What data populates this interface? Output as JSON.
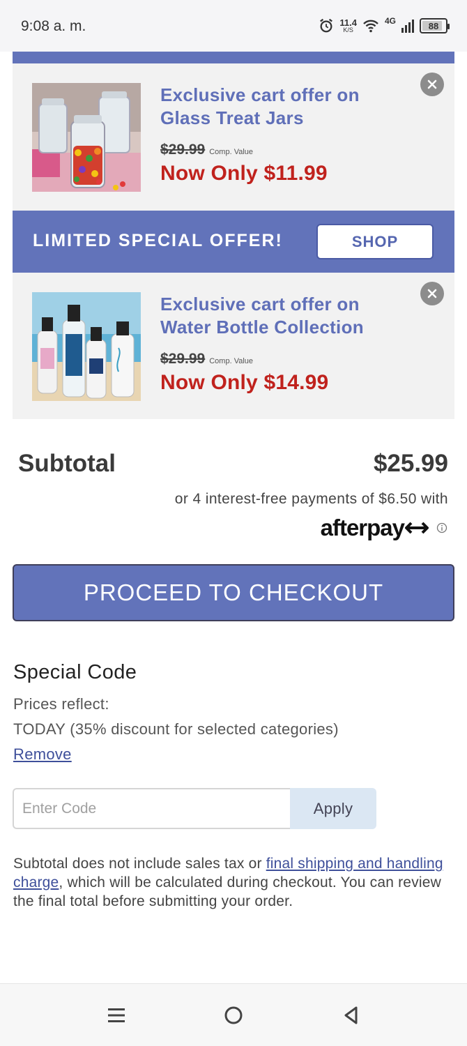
{
  "status_bar": {
    "time": "9:08 a. m.",
    "speed_value": "11.4",
    "speed_unit": "K/S",
    "network": "4G",
    "battery_level": "88",
    "battery_fraction": 0.88,
    "icons": [
      "alarm-icon",
      "wifi-icon",
      "signal-icon",
      "battery-icon"
    ]
  },
  "offers": [
    {
      "title": "Exclusive cart offer on Glass Treat Jars",
      "old_price": "$29.99",
      "comp_label": "Comp. Value",
      "now_price": "Now Only $11.99",
      "image": "glass-treat-jars-image"
    },
    {
      "title": "Exclusive cart offer on Water Bottle Collection",
      "old_price": "$29.99",
      "comp_label": "Comp. Value",
      "now_price": "Now Only $14.99",
      "image": "water-bottle-collection-image"
    }
  ],
  "limited_offer": {
    "text": "LIMITED SPECIAL OFFER!",
    "button": "SHOP"
  },
  "summary": {
    "subtotal_label": "Subtotal",
    "subtotal_value": "$25.99",
    "installments": "or 4 interest-free payments of $6.50 with",
    "afterpay": "afterpay"
  },
  "checkout_button": "PROCEED TO CHECKOUT",
  "special_code": {
    "title": "Special Code",
    "prices_reflect": "Prices reflect:",
    "today": "TODAY (35% discount for selected categories)",
    "remove": "Remove",
    "input_placeholder": "Enter Code",
    "apply": "Apply"
  },
  "disclaimer": {
    "before": "Subtotal does not include sales tax or ",
    "link": "final shipping and handling charge",
    "after": ", which will be calculated during checkout. You can review the final total before submitting your order."
  },
  "colors": {
    "brand_blue": "#6273ba",
    "offer_title": "#5f6fb8",
    "price_red": "#c0221d",
    "apply_bg": "#dbe7f3"
  }
}
